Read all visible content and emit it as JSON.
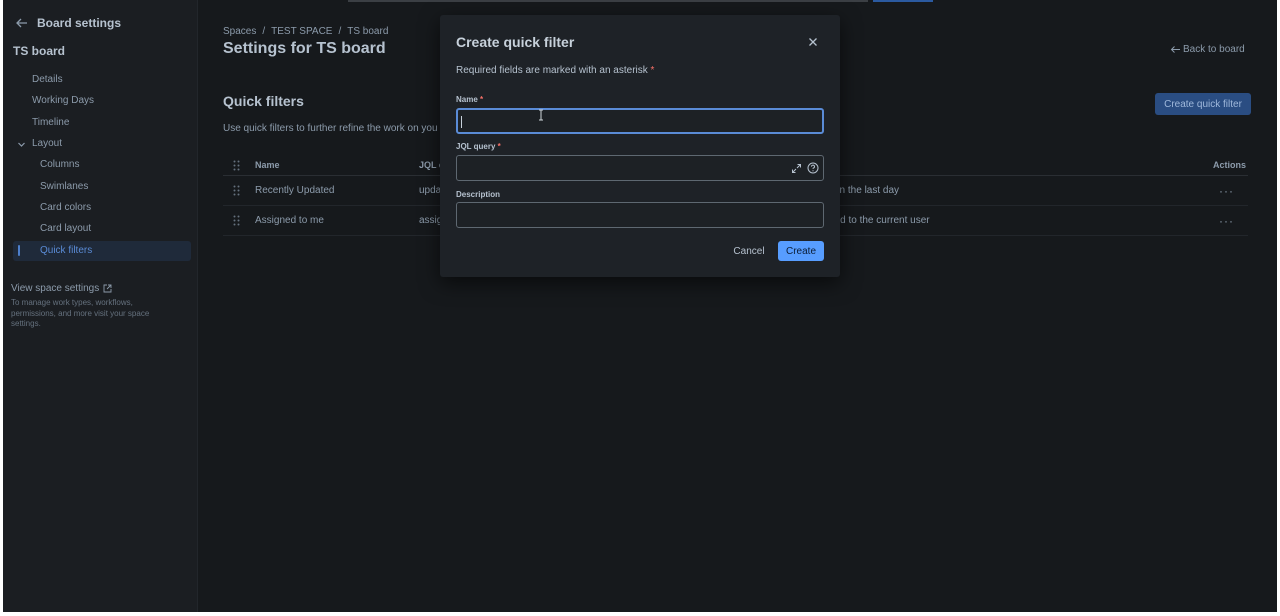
{
  "sidebar": {
    "back_label": "Board settings",
    "board_name": "TS board",
    "items": [
      {
        "label": "Details"
      },
      {
        "label": "Working Days"
      },
      {
        "label": "Timeline"
      },
      {
        "label": "Layout"
      }
    ],
    "layout_children": [
      {
        "label": "Columns"
      },
      {
        "label": "Swimlanes"
      },
      {
        "label": "Card colors"
      },
      {
        "label": "Card layout"
      },
      {
        "label": "Quick filters"
      }
    ],
    "view_space_settings": "View space settings",
    "view_space_desc": "To manage work types, workflows, permissions, and more visit your space settings."
  },
  "breadcrumb": [
    "Spaces",
    "/",
    "TEST SPACE",
    "/",
    "TS board"
  ],
  "page_title": "Settings for TS board",
  "back_to_board": "Back to board",
  "quick_filters": {
    "title": "Quick filters",
    "description": "Use quick filters to further refine the work on you",
    "create_button": "Create quick filter",
    "columns": {
      "name": "Name",
      "jql": "JQL c",
      "actions": "Actions"
    },
    "rows": [
      {
        "name": "Recently Updated",
        "jql": "upda",
        "desc": "d in the last day"
      },
      {
        "name": "Assigned to me",
        "jql": "assig",
        "desc": "ned to the current user"
      }
    ]
  },
  "modal": {
    "title": "Create quick filter",
    "required_note": "Required fields are marked with an asterisk",
    "asterisk": "*",
    "name_label": "Name",
    "name_value": "",
    "jql_label": "JQL query",
    "jql_value": "",
    "description_label": "Description",
    "description_value": "",
    "cancel_label": "Cancel",
    "create_label": "Create"
  },
  "colors": {
    "accent": "#579dff",
    "background": "#16191c",
    "modal_bg": "#1e2227",
    "required": "#f87168"
  }
}
